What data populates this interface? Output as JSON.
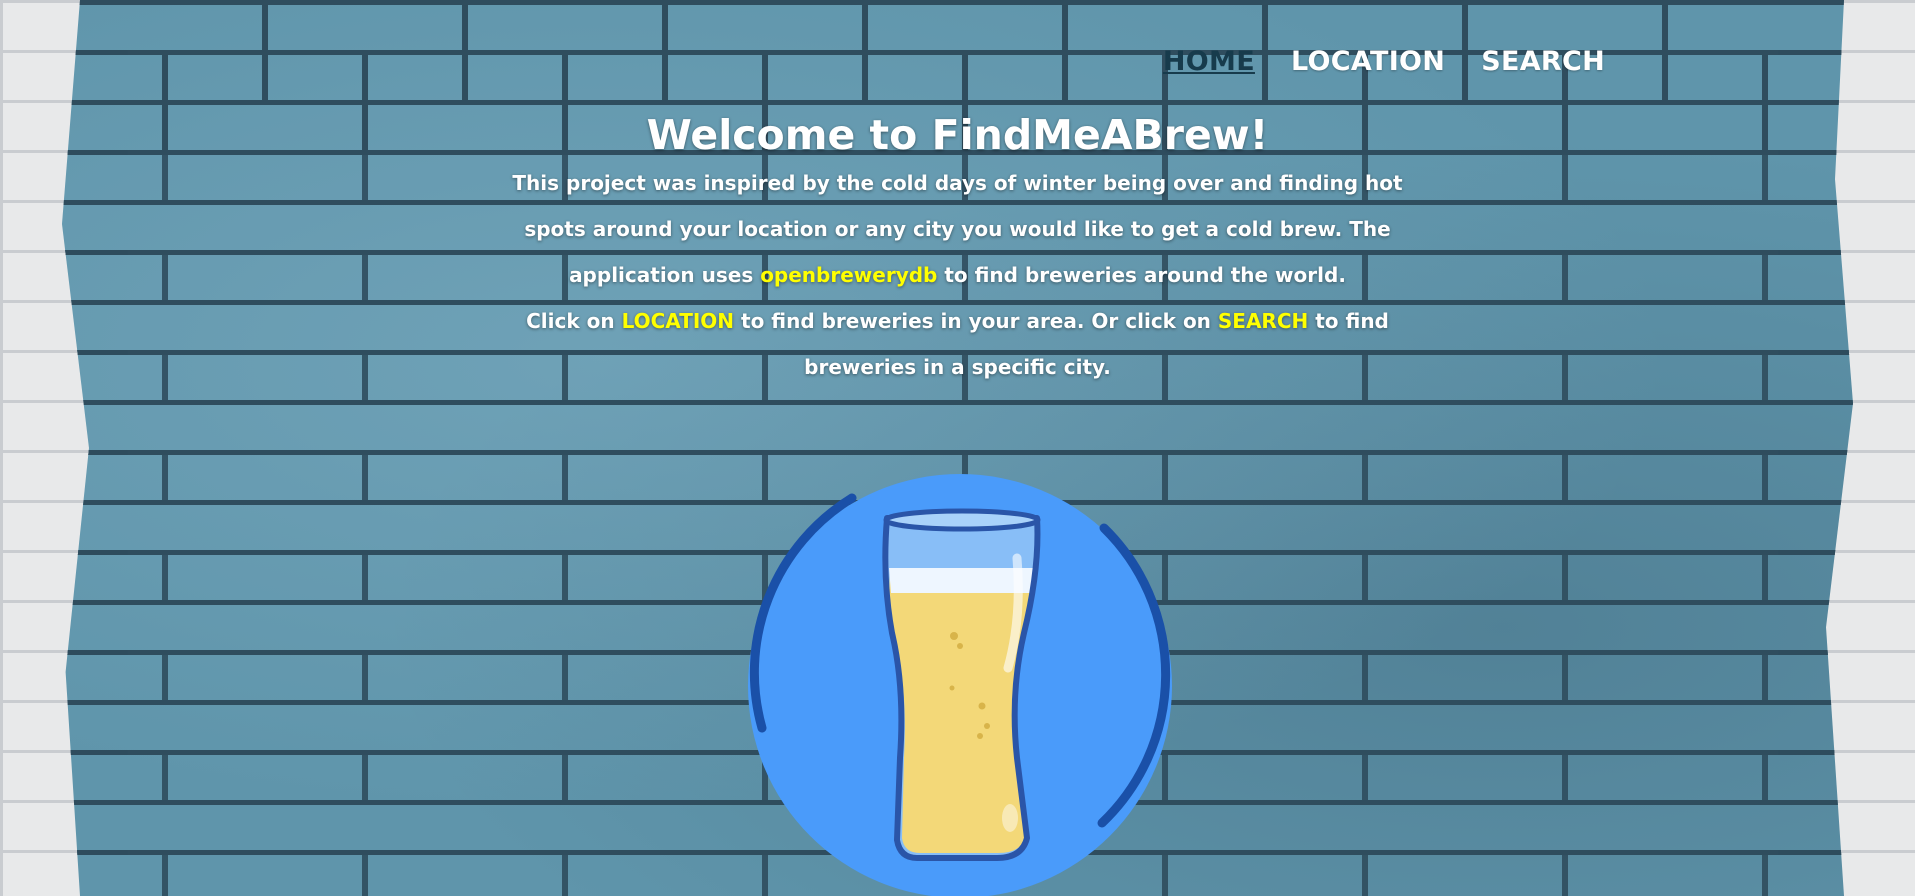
{
  "nav": {
    "home": "HOME",
    "location": "LOCATION",
    "search": "SEARCH"
  },
  "main": {
    "title": "Welcome to FindMeABrew!",
    "intro_before_link": "This project was inspired by the cold days of winter being over and finding hot spots around your location or any city you would like to get a cold brew. The application uses ",
    "api_link": "openbrewerydb",
    "intro_after_link": " to find breweries around the world.",
    "cta_1": "Click on ",
    "cta_location": "LOCATION",
    "cta_2": " to find breweries in your area. Or click on ",
    "cta_search": "SEARCH",
    "cta_3": " to find breweries in a specific city."
  },
  "illustration": {
    "icon": "beer-glass-icon"
  },
  "colors": {
    "highlight": "#ffff00",
    "active_nav": "#173b4c",
    "wall_blue": "#5f95ab",
    "circle_blue": "#4a9bfa",
    "beer": "#f3d878"
  }
}
